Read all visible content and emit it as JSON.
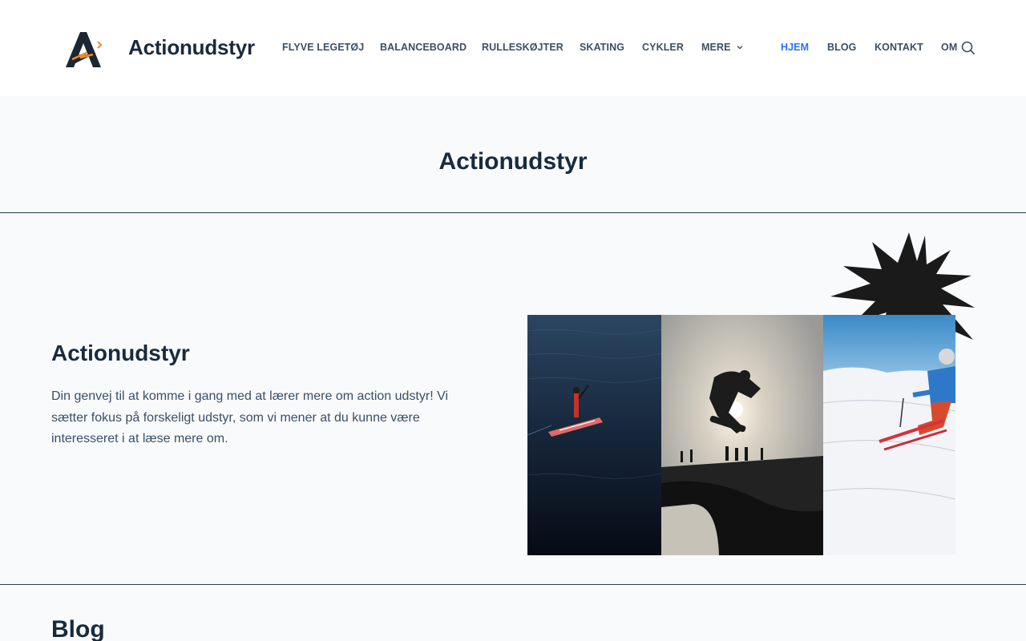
{
  "header": {
    "site_title": "Actionudstyr",
    "nav": [
      {
        "label": "FLYVE LEGETØJ"
      },
      {
        "label": "BALANCEBOARD"
      },
      {
        "label": "RULLESKØJTER"
      },
      {
        "label": "SKATING"
      },
      {
        "label": "CYKLER"
      },
      {
        "label": "MERE"
      }
    ],
    "secondary_nav": [
      {
        "label": "HJEM",
        "active": true
      },
      {
        "label": "BLOG"
      },
      {
        "label": "KONTAKT"
      },
      {
        "label": "OM"
      }
    ],
    "icons": {
      "logo": "actionudstyr-logo",
      "dropdown": "chevron-down-icon",
      "search": "search-icon"
    }
  },
  "page_title": "Actionudstyr",
  "hero": {
    "heading": "Actionudstyr",
    "text": "Din genvej til at komme i gang med at lærer mere om action udstyr! Vi sætter fokus på forskeligt udstyr, som vi mener at du kunne være interesseret i at læse mere om.",
    "images": [
      "paddleboard-photo",
      "skateboard-jump-photo",
      "skier-photo"
    ]
  },
  "blog": {
    "heading": "Blog"
  },
  "colors": {
    "accent": "#2872fa",
    "heading": "#192a3d",
    "body_text": "#3a4f66",
    "background": "#f9fafb",
    "logo_orange": "#f08a24"
  }
}
